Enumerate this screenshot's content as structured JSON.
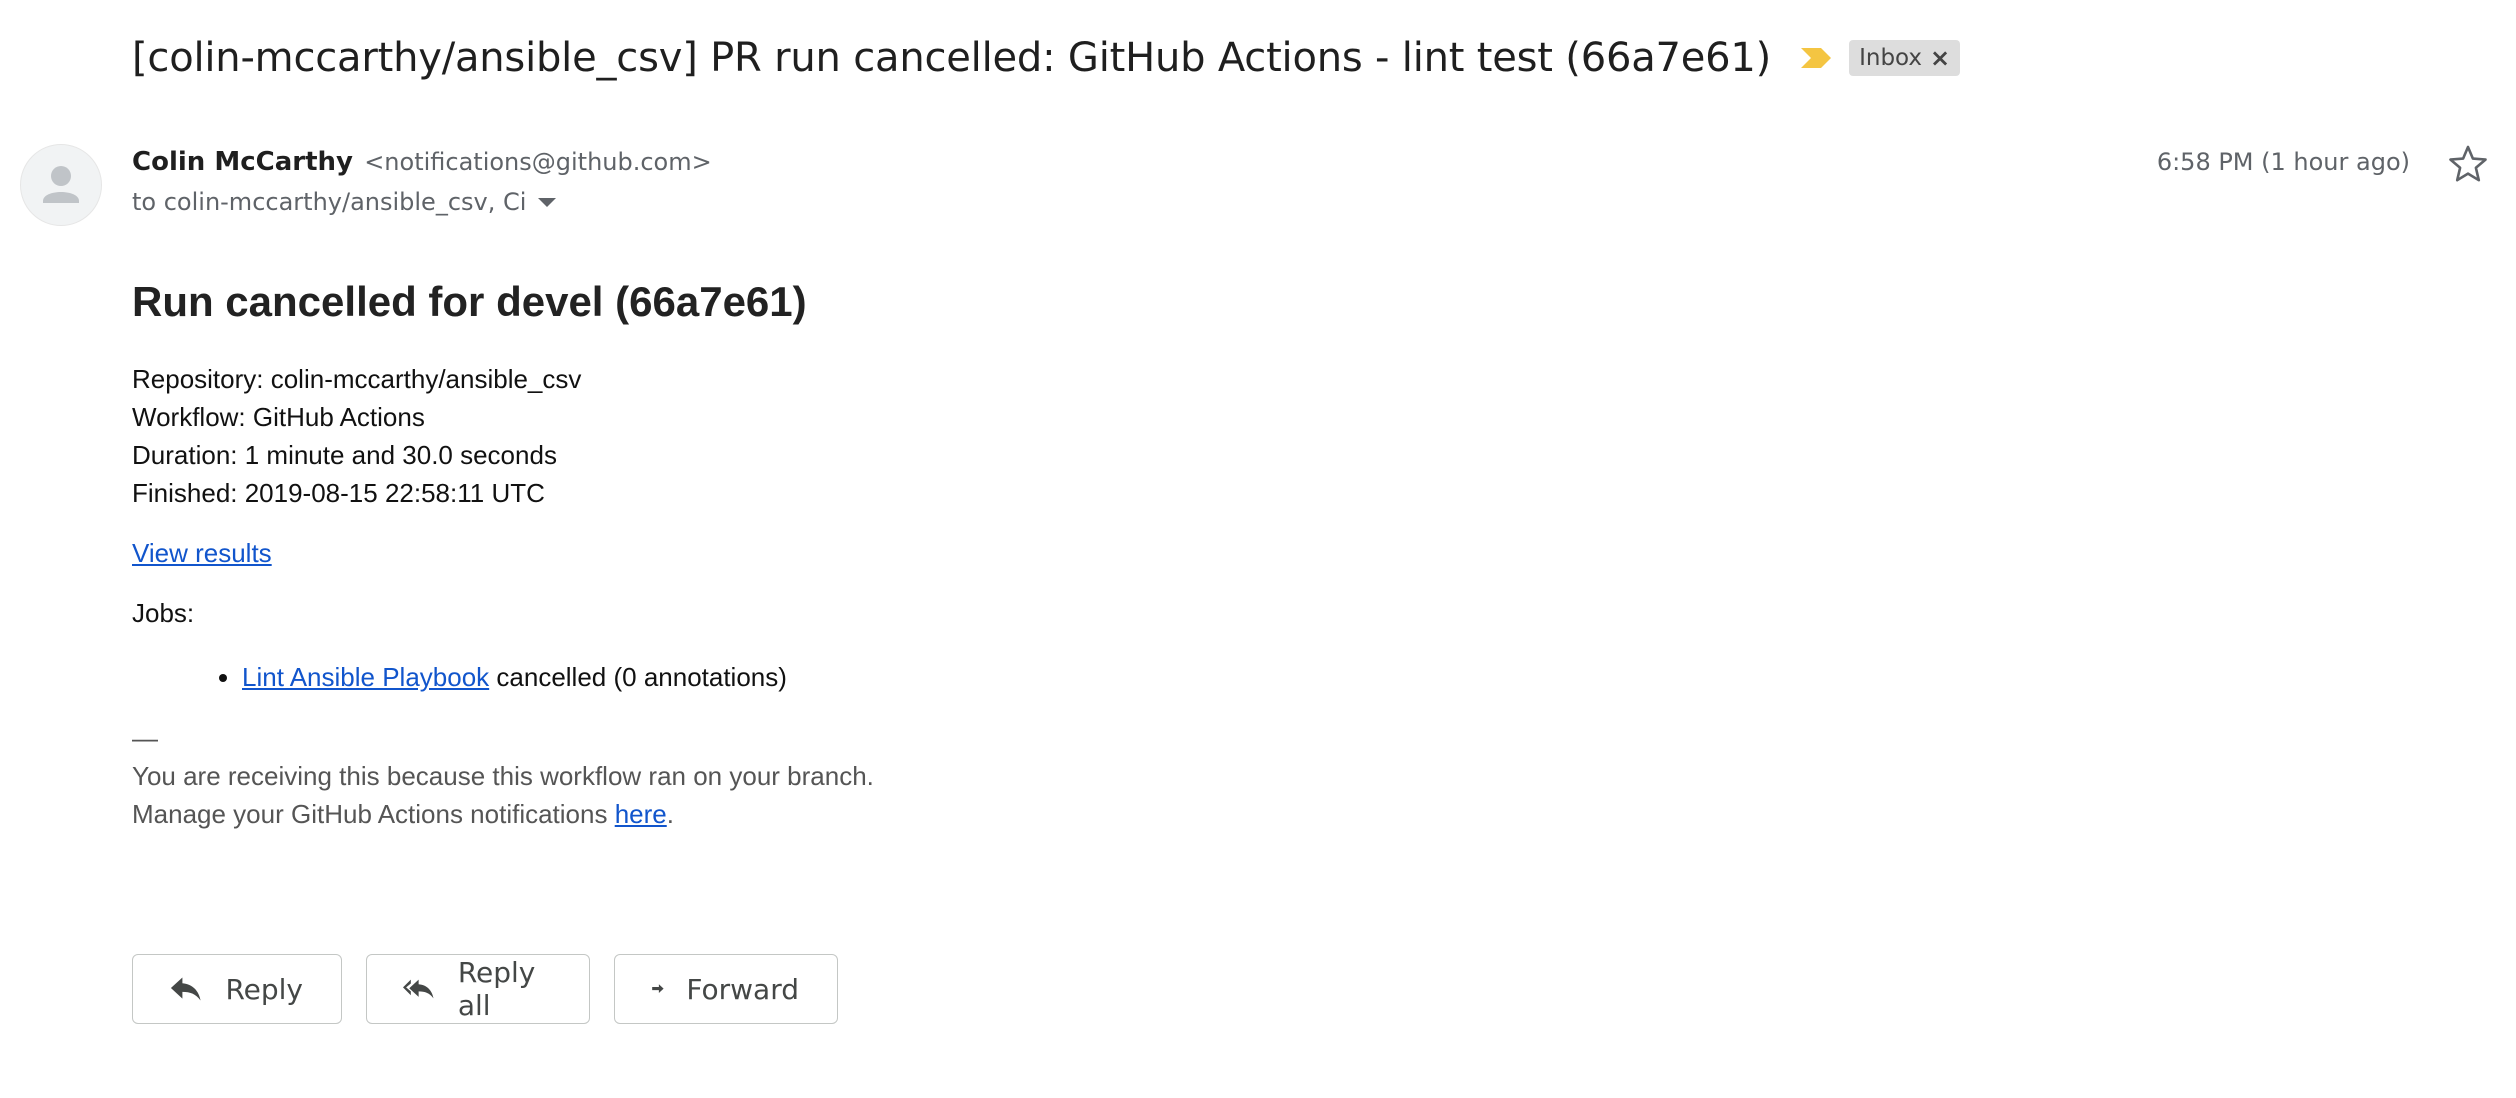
{
  "subject": "[colin-mccarthy/ansible_csv] PR run cancelled: GitHub Actions - lint test (66a7e61)",
  "label": {
    "name": "Inbox",
    "remove_glyph": "×"
  },
  "importance_color": "#f4c542",
  "sender": {
    "name": "Colin McCarthy",
    "email": "<notifications@github.com>",
    "to": "to colin-mccarthy/ansible_csv, Ci"
  },
  "timestamp": "6:58 PM (1 hour ago)",
  "body": {
    "heading": "Run cancelled for devel (66a7e61)",
    "repository": "Repository: colin-mccarthy/ansible_csv",
    "workflow": "Workflow: GitHub Actions",
    "duration": "Duration: 1 minute and 30.0 seconds",
    "finished": "Finished: 2019-08-15 22:58:11 UTC",
    "view_results": "View results",
    "jobs_label": "Jobs:",
    "jobs": [
      {
        "link": "Lint Ansible Playbook",
        "status": " cancelled (0 annotations)"
      }
    ],
    "dash": "—",
    "footer_line1": "You are receiving this because this workflow ran on your branch.",
    "footer_line2_prefix": "Manage your GitHub Actions notifications ",
    "footer_link": "here",
    "footer_line2_suffix": "."
  },
  "actions": {
    "reply": "Reply",
    "reply_all": "Reply all",
    "forward": "Forward"
  },
  "colors": {
    "link": "#1155cc",
    "chip_bg": "#dddddd"
  }
}
